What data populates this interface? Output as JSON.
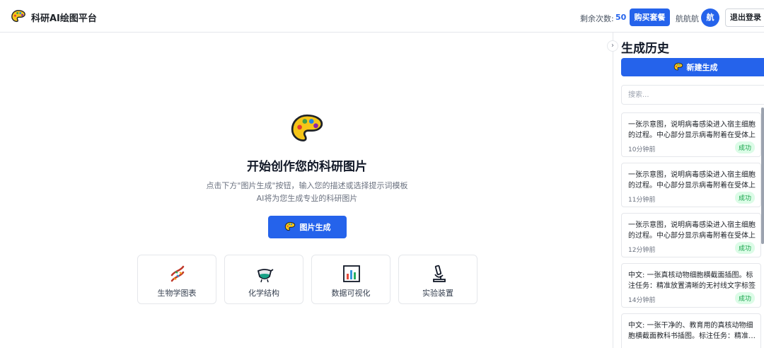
{
  "header": {
    "app_title": "科研AI绘图平台",
    "remain_label": "剩余次数:",
    "remain_count": "50",
    "buy_label": "购买套餐",
    "username": "航航航",
    "avatar_char": "航",
    "logout_label": "退出登录",
    "logo_icon": "palette-icon"
  },
  "main": {
    "title": "开始创作您的科研图片",
    "desc_line1": "点击下方\"图片生成\"按钮，输入您的描述或选择提示词模板",
    "desc_line2": "AI将为您生成专业的科研图片",
    "generate_label": "图片生成",
    "categories": [
      {
        "label": "生物学图表",
        "icon": "dna-icon"
      },
      {
        "label": "化学结构",
        "icon": "flask-icon"
      },
      {
        "label": "数据可视化",
        "icon": "bar-chart-icon"
      },
      {
        "label": "实验装置",
        "icon": "microscope-icon"
      }
    ]
  },
  "sidebar": {
    "title": "生成历史",
    "new_label": "新建生成",
    "search_placeholder": "搜索...",
    "history": [
      {
        "text": "一张示意图，说明病毒感染进入宿主细胞的过程。中心部分显示病毒附着在受体上",
        "time": "10分钟前",
        "status": "成功"
      },
      {
        "text": "一张示意图，说明病毒感染进入宿主细胞的过程。中心部分显示病毒附着在受体上",
        "time": "11分钟前",
        "status": "成功"
      },
      {
        "text": "一张示意图，说明病毒感染进入宿主细胞的过程。中心部分显示病毒附着在受体上",
        "time": "12分钟前",
        "status": "成功"
      },
      {
        "text": "中文: 一张真核动物细胞横截面插图。标注任务：精准放置清晰的无衬线文字标签",
        "time": "14分钟前",
        "status": "成功"
      },
      {
        "text": "中文: 一张干净的、教育用的真核动物细胞横截面教科书插图。标注任务：精准放置",
        "time": "",
        "status": ""
      }
    ]
  },
  "colors": {
    "primary": "#2563eb",
    "success_bg": "#dcfce7",
    "success_text": "#16a34a"
  }
}
